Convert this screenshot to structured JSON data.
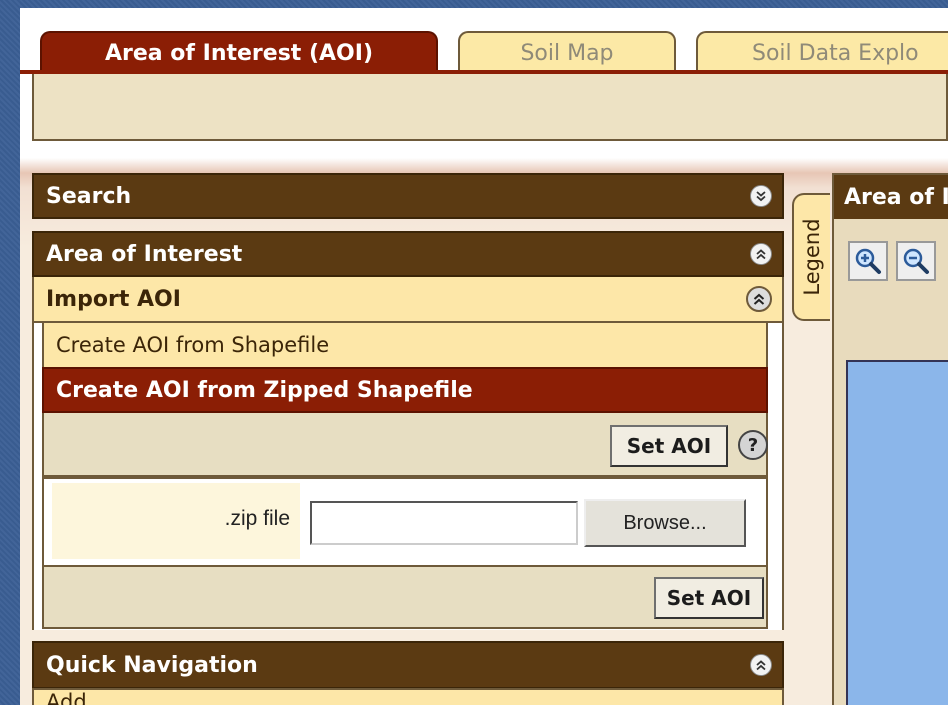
{
  "tabs": [
    {
      "label": "Area of Interest (AOI)",
      "active": true
    },
    {
      "label": "Soil Map",
      "active": false
    },
    {
      "label": "Soil Data Explo",
      "active": false
    }
  ],
  "panels": {
    "search": {
      "title": "Search",
      "icon": "chevron-down-double-icon"
    },
    "aoi": {
      "title": "Area of Interest",
      "icon": "chevron-up-double-icon",
      "import": {
        "title": "Import AOI",
        "icon": "chevron-up-double-icon",
        "options": [
          {
            "label": "Create AOI from Shapefile",
            "selected": false
          },
          {
            "label": "Create AOI from Zipped Shapefile",
            "selected": true
          }
        ],
        "set_aoi_label": "Set AOI",
        "help_label": "?",
        "zip_file_label": ".zip file",
        "zip_file_value": "",
        "browse_label": "Browse..."
      }
    },
    "quick_nav": {
      "title": "Quick Navigation",
      "icon": "chevron-up-double-icon",
      "first_item": "Add..."
    }
  },
  "legend_label": "Legend",
  "map": {
    "title": "Area of Interest",
    "tools": [
      "zoom-in-icon",
      "zoom-out-icon"
    ]
  },
  "colors": {
    "accent": "#8b1e05",
    "header": "#5b3a12",
    "tab_inactive": "#fce9a6",
    "map_water": "#8bb6ea"
  }
}
